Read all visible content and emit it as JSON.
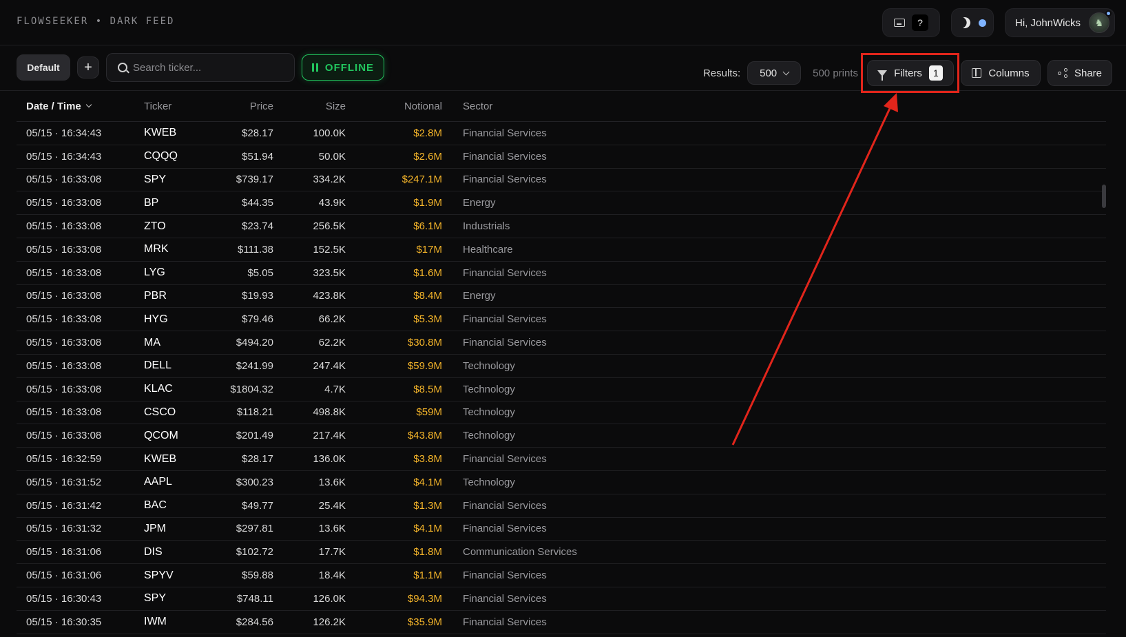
{
  "brand": "FLOWSEEKER • DARK FEED",
  "top": {
    "help_label": "?",
    "greeting": "Hi, JohnWicks"
  },
  "toolbar": {
    "default_label": "Default",
    "add_label": "+",
    "search_placeholder": "Search ticker...",
    "offline_label": "OFFLINE",
    "results_label": "Results:",
    "results_value": "500",
    "prints_label": "500 prints",
    "filters_label": "Filters",
    "filters_count": "1",
    "columns_label": "Columns",
    "share_label": "Share"
  },
  "table": {
    "headers": {
      "datetime": "Date / Time",
      "ticker": "Ticker",
      "price": "Price",
      "size": "Size",
      "notional": "Notional",
      "sector": "Sector"
    },
    "rows": [
      {
        "datetime": "05/15 · 16:34:43",
        "ticker": "KWEB",
        "price": "$28.17",
        "size": "100.0K",
        "notional": "$2.8M",
        "sector": "Financial Services"
      },
      {
        "datetime": "05/15 · 16:34:43",
        "ticker": "CQQQ",
        "price": "$51.94",
        "size": "50.0K",
        "notional": "$2.6M",
        "sector": "Financial Services"
      },
      {
        "datetime": "05/15 · 16:33:08",
        "ticker": "SPY",
        "price": "$739.17",
        "size": "334.2K",
        "notional": "$247.1M",
        "sector": "Financial Services"
      },
      {
        "datetime": "05/15 · 16:33:08",
        "ticker": "BP",
        "price": "$44.35",
        "size": "43.9K",
        "notional": "$1.9M",
        "sector": "Energy"
      },
      {
        "datetime": "05/15 · 16:33:08",
        "ticker": "ZTO",
        "price": "$23.74",
        "size": "256.5K",
        "notional": "$6.1M",
        "sector": "Industrials"
      },
      {
        "datetime": "05/15 · 16:33:08",
        "ticker": "MRK",
        "price": "$111.38",
        "size": "152.5K",
        "notional": "$17M",
        "sector": "Healthcare"
      },
      {
        "datetime": "05/15 · 16:33:08",
        "ticker": "LYG",
        "price": "$5.05",
        "size": "323.5K",
        "notional": "$1.6M",
        "sector": "Financial Services"
      },
      {
        "datetime": "05/15 · 16:33:08",
        "ticker": "PBR",
        "price": "$19.93",
        "size": "423.8K",
        "notional": "$8.4M",
        "sector": "Energy"
      },
      {
        "datetime": "05/15 · 16:33:08",
        "ticker": "HYG",
        "price": "$79.46",
        "size": "66.2K",
        "notional": "$5.3M",
        "sector": "Financial Services"
      },
      {
        "datetime": "05/15 · 16:33:08",
        "ticker": "MA",
        "price": "$494.20",
        "size": "62.2K",
        "notional": "$30.8M",
        "sector": "Financial Services"
      },
      {
        "datetime": "05/15 · 16:33:08",
        "ticker": "DELL",
        "price": "$241.99",
        "size": "247.4K",
        "notional": "$59.9M",
        "sector": "Technology"
      },
      {
        "datetime": "05/15 · 16:33:08",
        "ticker": "KLAC",
        "price": "$1804.32",
        "size": "4.7K",
        "notional": "$8.5M",
        "sector": "Technology"
      },
      {
        "datetime": "05/15 · 16:33:08",
        "ticker": "CSCO",
        "price": "$118.21",
        "size": "498.8K",
        "notional": "$59M",
        "sector": "Technology"
      },
      {
        "datetime": "05/15 · 16:33:08",
        "ticker": "QCOM",
        "price": "$201.49",
        "size": "217.4K",
        "notional": "$43.8M",
        "sector": "Technology"
      },
      {
        "datetime": "05/15 · 16:32:59",
        "ticker": "KWEB",
        "price": "$28.17",
        "size": "136.0K",
        "notional": "$3.8M",
        "sector": "Financial Services"
      },
      {
        "datetime": "05/15 · 16:31:52",
        "ticker": "AAPL",
        "price": "$300.23",
        "size": "13.6K",
        "notional": "$4.1M",
        "sector": "Technology"
      },
      {
        "datetime": "05/15 · 16:31:42",
        "ticker": "BAC",
        "price": "$49.77",
        "size": "25.4K",
        "notional": "$1.3M",
        "sector": "Financial Services"
      },
      {
        "datetime": "05/15 · 16:31:32",
        "ticker": "JPM",
        "price": "$297.81",
        "size": "13.6K",
        "notional": "$4.1M",
        "sector": "Financial Services"
      },
      {
        "datetime": "05/15 · 16:31:06",
        "ticker": "DIS",
        "price": "$102.72",
        "size": "17.7K",
        "notional": "$1.8M",
        "sector": "Communication Services"
      },
      {
        "datetime": "05/15 · 16:31:06",
        "ticker": "SPYV",
        "price": "$59.88",
        "size": "18.4K",
        "notional": "$1.1M",
        "sector": "Financial Services"
      },
      {
        "datetime": "05/15 · 16:30:43",
        "ticker": "SPY",
        "price": "$748.11",
        "size": "126.0K",
        "notional": "$94.3M",
        "sector": "Financial Services"
      },
      {
        "datetime": "05/15 · 16:30:35",
        "ticker": "IWM",
        "price": "$284.56",
        "size": "126.2K",
        "notional": "$35.9M",
        "sector": "Financial Services"
      }
    ]
  },
  "colors": {
    "accent_green": "#22c55e",
    "notional_gold": "#f5b52a",
    "annotation_red": "#e1251b",
    "status_blue": "#7fb3ff"
  },
  "icons": [
    "keyboard-icon",
    "moon-icon",
    "search-icon",
    "pause-icon",
    "chevron-down-icon",
    "filter-icon",
    "columns-icon",
    "share-icon"
  ]
}
